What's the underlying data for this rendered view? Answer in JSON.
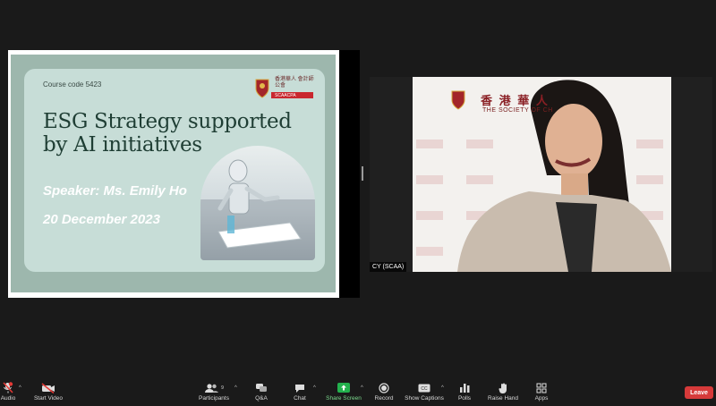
{
  "slide": {
    "course_code": "Course code 5423",
    "title_line1": "ESG  Strategy  supported",
    "title_line2": "by AI initiatives",
    "speaker": "Speaker: Ms. Emily Ho",
    "date": "20 December 2023",
    "logo_chinese": "香港華人 會計師公會",
    "logo_abbr": "SCAACPA"
  },
  "video": {
    "participant_name": "CY (SCAA)",
    "backdrop_chinese": "香 港 華 人",
    "backdrop_english": "THE SOCIETY OF CH"
  },
  "toolbar": {
    "audio": "Audio",
    "start_video": "Start Video",
    "participants": "Participants",
    "participants_count": "9",
    "qa": "Q&A",
    "chat": "Chat",
    "share_screen": "Share Screen",
    "record": "Record",
    "show_captions": "Show Captions",
    "polls": "Polls",
    "raise_hand": "Raise Hand",
    "apps": "Apps",
    "leave": "Leave"
  },
  "colors": {
    "share_green": "#23b14d",
    "leave_red": "#d63a3a",
    "slide_title": "#1f3e34"
  }
}
